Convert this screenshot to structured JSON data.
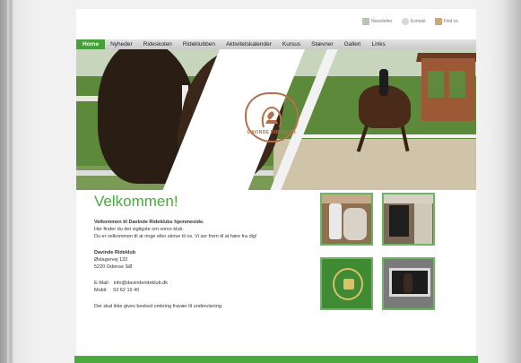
{
  "utility_links": [
    {
      "label": "Newsletter",
      "icon": "newsletter-icon"
    },
    {
      "label": "Kontakt",
      "icon": "contact-icon"
    },
    {
      "label": "Find os",
      "icon": "map-icon"
    }
  ],
  "nav": {
    "tabs": [
      {
        "label": "Home",
        "active": true
      },
      {
        "label": "Nyheder",
        "active": false
      },
      {
        "label": "Rideskolen",
        "active": false
      },
      {
        "label": "Rideklubben",
        "active": false
      },
      {
        "label": "Aktivitetskalender",
        "active": false
      },
      {
        "label": "Kursus",
        "active": false
      },
      {
        "label": "Stævner",
        "active": false
      },
      {
        "label": "Galleri",
        "active": false
      },
      {
        "label": "Links",
        "active": false
      }
    ]
  },
  "banner": {
    "logo_text": "DAVINDE RIDEKLUB"
  },
  "main": {
    "heading": "Velkommen!",
    "intro_bold": "Velkommen til Davinde Rideklubs hjemmeside.",
    "intro_line2": "Her finder du det vigtigste om vores klub.",
    "intro_line3": "Du er velkommen til at ringe eller skrive til os. Vi ser frem til at høre fra dig!",
    "address_name": "Davinde Rideklub",
    "address_street": "Østagervej 132",
    "address_city": "5220 Odense SØ",
    "email_label": "E-Mail:",
    "email_value": "info@davinderideklub.dk",
    "phone_label": "Mobil:",
    "phone_value": "53 62 19 40",
    "notice": "Der skal ikke gives besked omkring fravær til undervisning."
  },
  "colors": {
    "accent": "#4aa93f",
    "logo": "#b4704a"
  }
}
